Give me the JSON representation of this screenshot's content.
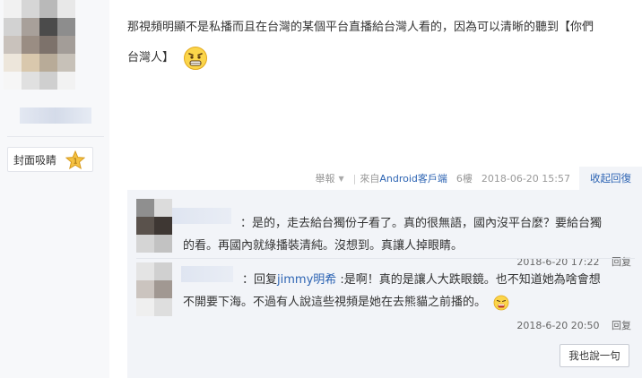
{
  "sidebar": {
    "medal_label": "封面吸睛",
    "medal_number": "1"
  },
  "post": {
    "body_line1": "那視頻明顯不是私播而且在台灣的某個平台直播給台灣人看的，因為可以清晰的聽到【你們",
    "body_line2": "台灣人】",
    "emoji": "grin-emoji"
  },
  "meta": {
    "report": "舉報",
    "source_prefix": "來自",
    "source_client": "Android客戶端",
    "floor": "6樓",
    "time": "2018-06-20 15:57",
    "collapse": "收起回復"
  },
  "replies": [
    {
      "text_line1": "：是的，走去給台獨份子看了。真的很無語，國內沒平台麼？要給台獨",
      "text_line2": "的看。再國內就綠播裝清純。沒想到。真讓人掉眼睛。",
      "time": "2018-6-20 17:22",
      "reply_label": "回复"
    },
    {
      "prefix": "：回复",
      "mention": "jimmy明希",
      "text_line1": " :是啊！真的是讓人大跌眼鏡。也不知道她為啥會想",
      "text_line2": "不開要下海。不過有人說這些視頻是她在去熊貓之前播的。",
      "time": "2018-6-20 20:50",
      "reply_label": "回复"
    }
  ],
  "say_button": "我也說一句",
  "colors": {
    "link": "#2d64b3",
    "reply_bg": "#f2f4f8",
    "sidebar_bg": "#f7f8fa"
  }
}
